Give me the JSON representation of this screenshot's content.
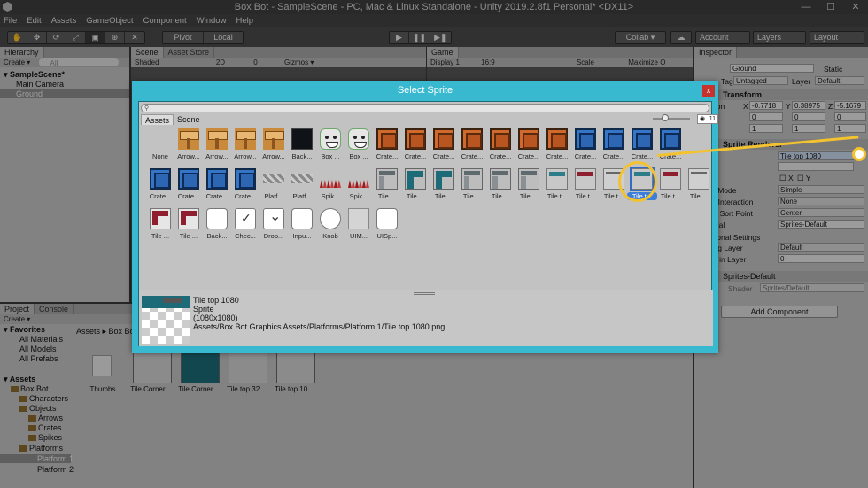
{
  "window": {
    "title": "Box Bot - SampleScene - PC, Mac & Linux Standalone - Unity 2019.2.8f1 Personal* <DX11>"
  },
  "menu": [
    "File",
    "Edit",
    "Assets",
    "GameObject",
    "Component",
    "Window",
    "Help"
  ],
  "toolbar": {
    "pivot": "Pivot",
    "local": "Local",
    "collab": "Collab ▾",
    "account": "Account",
    "layers": "Layers",
    "layout": "Layout"
  },
  "hierarchy": {
    "tab": "Hierarchy",
    "create": "Create ▾",
    "search": "All",
    "scene": "SampleScene*",
    "items": [
      "Main Camera",
      "Ground"
    ]
  },
  "scene_view": {
    "tabs": [
      "Scene",
      "Asset Store"
    ],
    "shaded": "Shaded",
    "mode_2d": "2D",
    "gizmos": "Gizmos ▾",
    "counter": "0"
  },
  "game_view": {
    "tab": "Game",
    "display": "Display 1",
    "aspect": "16:9",
    "scale": "Scale",
    "maximize": "Maximize O"
  },
  "inspector": {
    "tab": "Inspector",
    "object_name": "Ground",
    "static": "Static",
    "tag_label": "Tag",
    "tag": "Untagged",
    "layer_label": "Layer",
    "layer": "Default",
    "transform": "Transform",
    "position_label": "Position",
    "pos": [
      "-0.7718",
      "0.38975",
      "-5.1679"
    ],
    "rot": [
      "0",
      "0",
      "0"
    ],
    "scale": [
      "1",
      "1",
      "1"
    ],
    "axes": [
      "X",
      "Y",
      "Z"
    ],
    "sprite_renderer": "Sprite Renderer",
    "sprite_value": "Tile top 1080",
    "flip": [
      "X",
      "Y"
    ],
    "draw_mode_label": "Draw Mode",
    "draw_mode": "Simple",
    "mask_label": "Mask Interaction",
    "mask": "None",
    "sort_point_label": "Sprite Sort Point",
    "sort_point": "Center",
    "material_label": "Material",
    "material": "Sprites-Default",
    "additional": "Additional Settings",
    "sorting_layer_label": "Sorting Layer",
    "sorting_layer": "Default",
    "order_label": "Order in Layer",
    "order": "0",
    "mat_header": "Sprites-Default",
    "shader_label": "Shader",
    "shader": "Sprites/Default",
    "add_component": "Add Component"
  },
  "project": {
    "tabs": [
      "Project",
      "Console"
    ],
    "create": "Create ▾",
    "favorites": "Favorites",
    "fav_items": [
      "All Materials",
      "All Models",
      "All Prefabs"
    ],
    "assets": "Assets",
    "tree": [
      "Box Bot",
      "Characters",
      "Objects",
      "Arrows",
      "Crates",
      "Spikes",
      "Platforms",
      "Platform 1",
      "Platform 2"
    ],
    "breadcrumb": [
      "Assets",
      "Box Bot"
    ],
    "files": [
      "Thumbs",
      "Tile Corner...",
      "Tile Corner...",
      "Tile top 32...",
      "Tile top 10..."
    ]
  },
  "dialog": {
    "title": "Select Sprite",
    "close": "x",
    "tabs": [
      "Assets",
      "Scene"
    ],
    "hidden_count": "11",
    "sprites_row1": [
      {
        "label": "None",
        "kind": "none"
      },
      {
        "label": "Arrow...",
        "kind": "arrow"
      },
      {
        "label": "Arrow...",
        "kind": "arrow"
      },
      {
        "label": "Arrow...",
        "kind": "arrow"
      },
      {
        "label": "Arrow...",
        "kind": "arrow"
      },
      {
        "label": "Back...",
        "kind": "bg"
      },
      {
        "label": "Box ...",
        "kind": "box"
      },
      {
        "label": "Box ...",
        "kind": "box"
      },
      {
        "label": "Crate...",
        "kind": "crate-o"
      },
      {
        "label": "Crate...",
        "kind": "crate-o"
      },
      {
        "label": "Crate...",
        "kind": "crate-o"
      },
      {
        "label": "Crate...",
        "kind": "crate-o"
      },
      {
        "label": "Crate...",
        "kind": "crate-o"
      },
      {
        "label": "Crate...",
        "kind": "crate-o"
      },
      {
        "label": "Crate...",
        "kind": "crate-o"
      },
      {
        "label": "Crate...",
        "kind": "crate-b"
      },
      {
        "label": "Crate...",
        "kind": "crate-b"
      },
      {
        "label": "Crate...",
        "kind": "crate-b"
      },
      {
        "label": "Crate...",
        "kind": "crate-b"
      }
    ],
    "sprites_row2": [
      {
        "label": "Crate...",
        "kind": "crate-b"
      },
      {
        "label": "Crate...",
        "kind": "crate-b"
      },
      {
        "label": "Crate...",
        "kind": "crate-b"
      },
      {
        "label": "Crate...",
        "kind": "crate-b"
      },
      {
        "label": "Platf...",
        "kind": "plat"
      },
      {
        "label": "Platf...",
        "kind": "plat"
      },
      {
        "label": "Spik...",
        "kind": "spike"
      },
      {
        "label": "Spik...",
        "kind": "spike"
      },
      {
        "label": "Tile ...",
        "kind": "tile-g"
      },
      {
        "label": "Tile ...",
        "kind": "tile-t"
      },
      {
        "label": "Tile ...",
        "kind": "tile-t"
      },
      {
        "label": "Tile ...",
        "kind": "tile-g"
      },
      {
        "label": "Tile ...",
        "kind": "tile-g"
      },
      {
        "label": "Tile ...",
        "kind": "tile-g"
      },
      {
        "label": "Tile t...",
        "kind": "tile-gt"
      },
      {
        "label": "Tile t...",
        "kind": "tile-gr"
      },
      {
        "label": "Tile t...",
        "kind": "tile-plain"
      },
      {
        "label": "Tile t...",
        "kind": "tile-gt",
        "selected": true
      },
      {
        "label": "Tile t...",
        "kind": "tile-gr"
      },
      {
        "label": "Tile ...",
        "kind": "tile-plain"
      }
    ],
    "sprites_row3": [
      {
        "label": "Tile ...",
        "kind": "tile-r"
      },
      {
        "label": "Tile ...",
        "kind": "tile-r"
      },
      {
        "label": "Back...",
        "kind": "ui"
      },
      {
        "label": "Chec...",
        "kind": "check"
      },
      {
        "label": "Drop...",
        "kind": "drop"
      },
      {
        "label": "Inpu...",
        "kind": "ui"
      },
      {
        "label": "Knob",
        "kind": "knob"
      },
      {
        "label": "UIM...",
        "kind": "uimask"
      },
      {
        "label": "UISp...",
        "kind": "ui"
      }
    ],
    "preview": {
      "name": "Tile top 1080",
      "type": "Sprite",
      "size": "(1080x1080)",
      "path": "Assets/Box Bot  Graphics Assets/Platforms/Platform 1/Tile top 1080.png"
    }
  },
  "colors": {
    "dialog_frame": "#38b9cf",
    "highlight": "#f2c230",
    "selection": "#3d7fd8"
  }
}
